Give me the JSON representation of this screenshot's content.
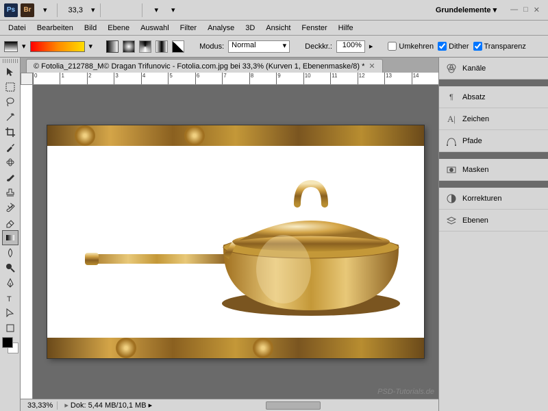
{
  "topbar": {
    "zoom": "33,3",
    "workspace": "Grundelemente"
  },
  "menu": [
    "Datei",
    "Bearbeiten",
    "Bild",
    "Ebene",
    "Auswahl",
    "Filter",
    "Analyse",
    "3D",
    "Ansicht",
    "Fenster",
    "Hilfe"
  ],
  "options": {
    "modusLabel": "Modus:",
    "modusValue": "Normal",
    "deckkrLabel": "Deckkr.:",
    "deckkrValue": "100%",
    "umkehren": "Umkehren",
    "dither": "Dither",
    "transparenz": "Transparenz"
  },
  "document": {
    "tab": "© Fotolia_212788_M© Dragan Trifunovic - Fotolia.com.jpg bei 33,3% (Kurven 1, Ebenenmaske/8) *"
  },
  "ruler": [
    "0",
    "1",
    "2",
    "3",
    "4",
    "5",
    "6",
    "7",
    "8",
    "9",
    "10",
    "11",
    "12",
    "13",
    "14"
  ],
  "status": {
    "zoom": "33,33%",
    "dok": "Dok: 5,44 MB/10,1 MB"
  },
  "panels": [
    {
      "label": "Kanäle",
      "icon": "channels"
    },
    {
      "label": "Absatz",
      "icon": "paragraph"
    },
    {
      "label": "Zeichen",
      "icon": "character"
    },
    {
      "label": "Pfade",
      "icon": "paths"
    },
    {
      "label": "Masken",
      "icon": "masks"
    },
    {
      "label": "Korrekturen",
      "icon": "adjust"
    },
    {
      "label": "Ebenen",
      "icon": "layers"
    }
  ],
  "watermark": "PSD-Tutorials.de"
}
